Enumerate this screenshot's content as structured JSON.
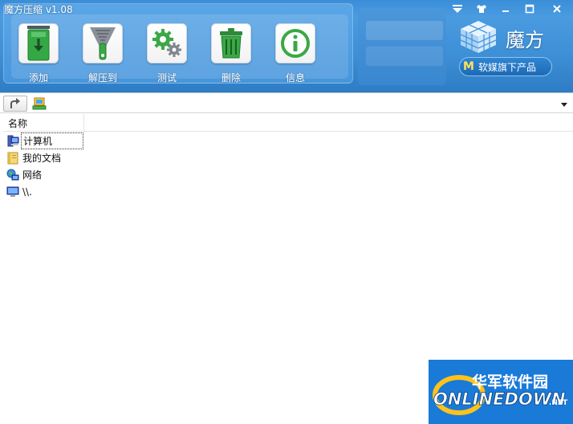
{
  "window": {
    "title": "魔方压缩 v1.08"
  },
  "toolbar": {
    "items": [
      {
        "label": "添加",
        "icon": "add-download-icon"
      },
      {
        "label": "解压到",
        "icon": "zipper-icon"
      },
      {
        "label": "测试",
        "icon": "gears-icon"
      },
      {
        "label": "删除",
        "icon": "trash-icon"
      },
      {
        "label": "信息",
        "icon": "info-icon"
      }
    ]
  },
  "brand": {
    "name": "魔方",
    "tagline_mark": "M",
    "tagline": "软媒旗下产品"
  },
  "address": {
    "value": ""
  },
  "list": {
    "column_header": "名称",
    "items": [
      {
        "label": "计算机",
        "icon": "computer-icon"
      },
      {
        "label": "我的文档",
        "icon": "documents-folder-icon"
      },
      {
        "label": "网络",
        "icon": "network-icon"
      },
      {
        "label": "\\\\.",
        "icon": "monitor-icon"
      }
    ]
  },
  "watermark": {
    "line1": "华军软件园",
    "line2": "ONLINEDOWN",
    "line3": ".NET"
  },
  "colors": {
    "header_blue": "#3d8fd6",
    "icon_green": "#2e9b3c",
    "watermark_blue": "#1a7ad8"
  }
}
